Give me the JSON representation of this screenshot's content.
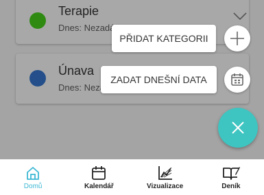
{
  "categories": [
    {
      "name": "Terapie",
      "subtitle": "Dnes: Nezadáno",
      "color": "#2f8a12"
    },
    {
      "name": "Únava",
      "subtitle": "Dnes: Nezadáno",
      "color": "#244f8a"
    }
  ],
  "speed_dial": {
    "add_category_label": "PŘIDAT KATEGORII",
    "enter_today_label": "ZADAT DNEŠNÍ DATA",
    "add_icon": "plus-icon",
    "calendar_icon": "calendar-icon",
    "close_icon": "close-icon",
    "accent_color": "#3ec5c1"
  },
  "nav": {
    "items": [
      {
        "label": "Domů",
        "icon": "home-icon",
        "active": true
      },
      {
        "label": "Kalendář",
        "icon": "calendar-icon"
      },
      {
        "label": "Vizualizace",
        "icon": "chart-icon"
      },
      {
        "label": "Deník",
        "icon": "diary-icon"
      }
    ],
    "active_color": "#3cb8d4"
  }
}
